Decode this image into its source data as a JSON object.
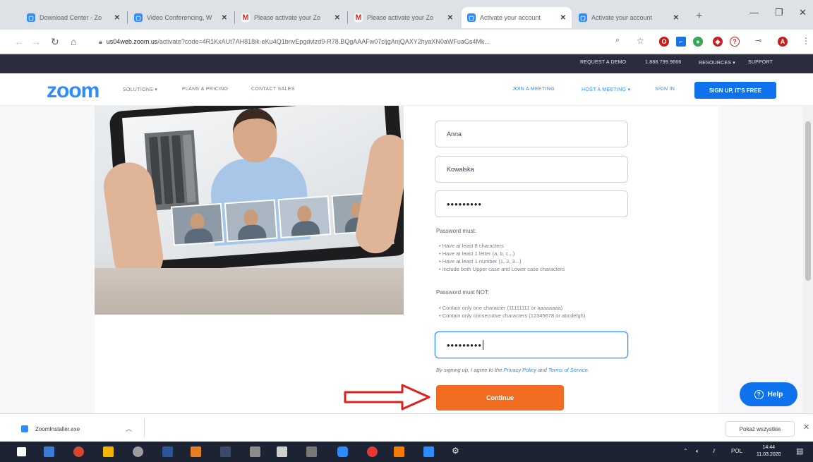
{
  "browser": {
    "tabs": [
      {
        "title": "Download Center - Zo",
        "icon": "zoom-favicon"
      },
      {
        "title": "Video Conferencing, W",
        "icon": "zoom-favicon"
      },
      {
        "title": "Please activate your Zo",
        "icon": "gmail-favicon"
      },
      {
        "title": "Please activate your Zo",
        "icon": "gmail-favicon"
      },
      {
        "title": "Activate your account",
        "icon": "zoom-favicon"
      },
      {
        "title": "Activate your account",
        "icon": "zoom-favicon"
      }
    ],
    "url_host": "us04web.zoom.us",
    "url_path": "/activate?code=4R1KxAUt7AH818ik-eKu4Q1bnvEpgdvlzd9-R78.BQgAAAFw07cljgAnjQAXY2hyaXN0aWFuaGs4Mk...",
    "accent": "#2d8cff"
  },
  "zoom": {
    "topbar": {
      "request_demo": "REQUEST A DEMO",
      "phone": "1.888.799.9666",
      "resources": "RESOURCES ▾",
      "support": "SUPPORT"
    },
    "nav": {
      "logo": "zoom",
      "solutions": "SOLUTIONS ▾",
      "plans": "PLANS & PRICING",
      "contact": "CONTACT SALES",
      "join": "JOIN A MEETING",
      "host": "HOST A MEETING ▾",
      "signin": "SIGN IN",
      "signup": "SIGN UP, IT'S FREE"
    },
    "form": {
      "first_name": "Anna",
      "last_name": "Kowalska",
      "password": "•••••••••",
      "confirm_password": "•••••••••",
      "password_must_heading": "Password must:",
      "password_must": [
        "Have at least 8 characters",
        "Have at least 1 letter (a, b, c...)",
        "Have at least 1 number (1, 2, 3...)",
        "Include both Upper case and Lower case characters"
      ],
      "password_must_not_heading": "Password must NOT:",
      "password_must_not": [
        "Contain only one character (11111111 or aaaaaaaa)",
        "Contain only consecutive characters (12345678 or abcdefgh)"
      ],
      "terms_prefix": "By signing up, I agree to the ",
      "privacy_link": "Privacy Policy",
      "terms_and": " and ",
      "terms_link": "Terms of Service",
      "terms_suffix": ".",
      "continue_label": "Continue",
      "continue_color": "#f26d21"
    },
    "help_label": "Help"
  },
  "downloads": {
    "file_name": "ZoomInstaller.exe",
    "show_all": "Pokaż wszystkie"
  },
  "taskbar": {
    "language": "POL",
    "time": "14:44",
    "date": "11.03.2020"
  }
}
